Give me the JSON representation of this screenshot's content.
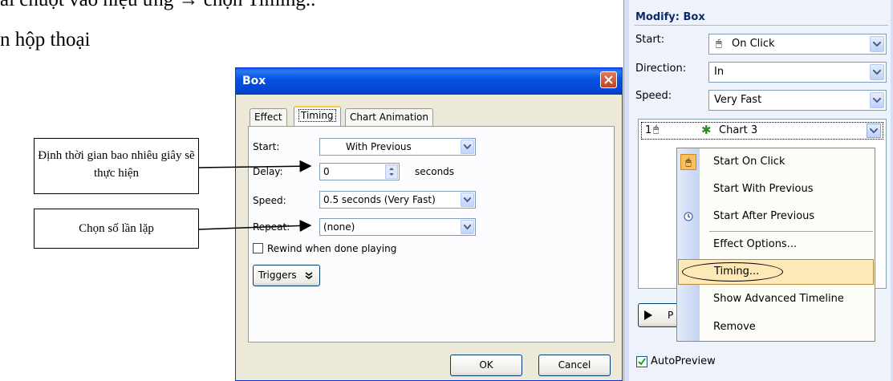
{
  "instructions": {
    "line1": "ải chuột vào hiệu ứng → chọn Timing..",
    "line2": "n hộp thoại"
  },
  "callouts": {
    "delay_note": "Định thời gian bao nhiêu giây sẽ thực hiện",
    "repeat_note": "Chọn số lần lặp"
  },
  "dialog": {
    "title": "Box",
    "tabs": [
      "Effect",
      "Timing",
      "Chart Animation"
    ],
    "start_label": "Start:",
    "start_value": "With Previous",
    "delay_label": "Delay:",
    "delay_value": "0",
    "delay_unit": "seconds",
    "speed_label": "Speed:",
    "speed_value": "0.5 seconds (Very Fast)",
    "repeat_label": "Repeat:",
    "repeat_value": "(none)",
    "rewind_label": "Rewind when done playing",
    "triggers_label": "Triggers",
    "ok_label": "OK",
    "cancel_label": "Cancel"
  },
  "task_pane": {
    "heading": "Modify: Box",
    "start_label": "Start:",
    "start_value": "On Click",
    "direction_label": "Direction:",
    "direction_value": "In",
    "speed_label": "Speed:",
    "speed_value": "Very Fast",
    "list_item_index": "1",
    "list_item_label": "Chart 3",
    "play_label": "P",
    "autopreview_label": "AutoPreview"
  },
  "context_menu": {
    "items": [
      "Start On Click",
      "Start With Previous",
      "Start After Previous",
      "Effect Options...",
      "Timing...",
      "Show Advanced Timeline",
      "Remove"
    ]
  }
}
